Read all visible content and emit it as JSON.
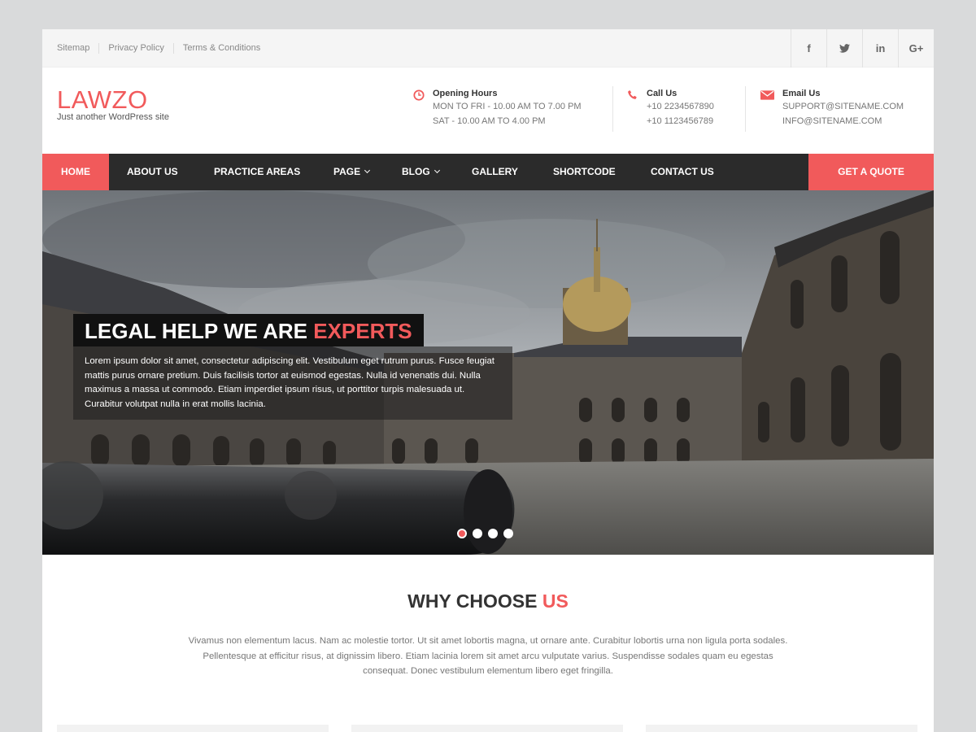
{
  "topbar": {
    "links": [
      "Sitemap",
      "Privacy Policy",
      "Terms & Conditions"
    ],
    "social": [
      {
        "icon": "facebook-icon",
        "glyph": "f"
      },
      {
        "icon": "twitter-icon",
        "glyph": "t"
      },
      {
        "icon": "linkedin-icon",
        "glyph": "in"
      },
      {
        "icon": "google-plus-icon",
        "glyph": "G+"
      }
    ]
  },
  "header": {
    "logo": "LAWZO",
    "tagline": "Just another WordPress site",
    "opening": {
      "title": "Opening Hours",
      "line1": "MON TO FRI - 10.00 AM TO 7.00 PM",
      "line2": "SAT - 10.00 AM TO 4.00 PM"
    },
    "call": {
      "title": "Call Us",
      "line1": "+10 2234567890",
      "line2": "+10 1123456789"
    },
    "email": {
      "title": "Email Us",
      "line1": "SUPPORT@SITENAME.COM",
      "line2": "INFO@SITENAME.COM"
    }
  },
  "nav": {
    "items": [
      "HOME",
      "ABOUT US",
      "PRACTICE AREAS",
      "PAGE",
      "BLOG",
      "GALLERY",
      "SHORTCODE",
      "CONTACT US"
    ],
    "cta": "GET A QUOTE"
  },
  "hero": {
    "headline_part1": "LEGAL HELP WE ARE",
    "headline_part2": "EXPERTS",
    "text": "Lorem ipsum dolor sit amet, consectetur adipiscing elit. Vestibulum eget rutrum purus. Fusce feugiat mattis purus ornare pretium. Duis facilisis tortor at euismod egestas. Nulla id venenatis dui. Nulla maximus a massa ut commodo. Etiam imperdiet ipsum risus, ut porttitor turpis malesuada ut. Curabitur volutpat nulla in erat mollis lacinia."
  },
  "why": {
    "title_part1": "WHY CHOOSE",
    "title_part2": "US",
    "text": "Vivamus non elementum lacus. Nam ac molestie tortor. Ut sit amet lobortis magna, ut ornare ante. Curabitur lobortis urna non ligula porta sodales. Pellentesque at efficitur risus, at dignissim libero. Etiam lacinia lorem sit amet arcu vulputate varius. Suspendisse sodales quam eu egestas consequat. Donec vestibulum elementum libero eget fringilla."
  },
  "colors": {
    "accent": "#f15a5b",
    "nav": "#2b2b2b"
  }
}
